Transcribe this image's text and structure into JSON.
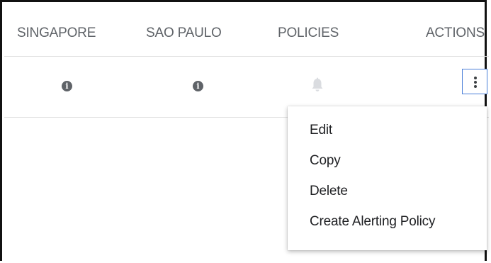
{
  "table": {
    "columns": [
      "SINGAPORE",
      "SAO PAULO",
      "POLICIES",
      "ACTIONS"
    ],
    "row": {
      "singapore_icon": "info-icon",
      "saopaulo_icon": "info-icon",
      "policies_icon": "bell-icon",
      "actions_icon": "more-vert-icon"
    }
  },
  "menu": {
    "items": [
      "Edit",
      "Copy",
      "Delete",
      "Create Alerting Policy"
    ]
  },
  "colors": {
    "header_text": "#5f6368",
    "icon_dark": "#5f6368",
    "bell_light": "#dadce0",
    "focus_border": "#4a7fd8",
    "divider": "#e0e0e0"
  }
}
